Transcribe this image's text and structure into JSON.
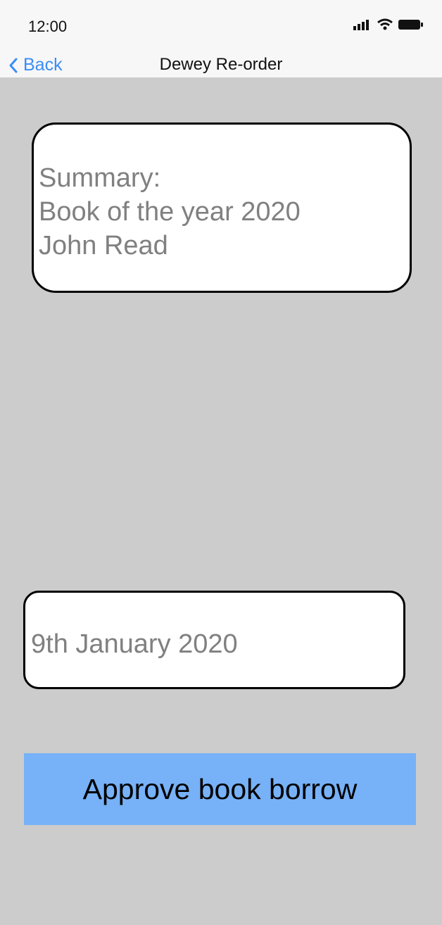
{
  "status_bar": {
    "time": "12:00",
    "icons": [
      "cellular-signal-icon",
      "wifi-icon",
      "battery-icon"
    ]
  },
  "nav": {
    "back_label": "Back",
    "title": "Dewey Re-order"
  },
  "summary": {
    "lines": [
      "Summary:",
      "Book of the year 2020",
      "John Read"
    ]
  },
  "date": {
    "value": "9th January 2020"
  },
  "approve_button": {
    "label": "Approve book borrow"
  },
  "colors": {
    "background": "#cccccc",
    "accent": "#3b8df7",
    "button": "#77b1f7",
    "text_secondary": "#808080"
  }
}
